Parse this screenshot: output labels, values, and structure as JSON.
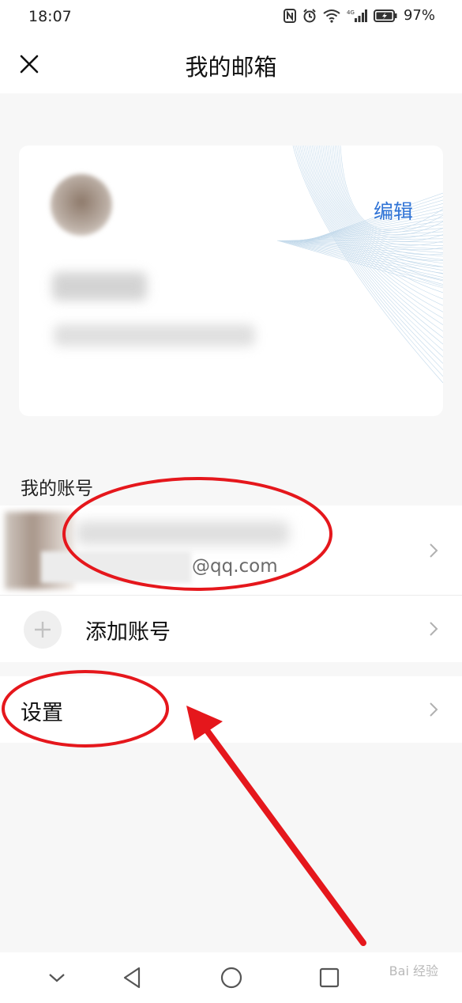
{
  "status_bar": {
    "time": "18:07",
    "battery_percent": "97%",
    "icons": [
      "nfc-icon",
      "alarm-icon",
      "wifi-icon",
      "4g-signal-icon",
      "battery-icon"
    ]
  },
  "header": {
    "title": "我的邮箱",
    "close_icon": "close-icon"
  },
  "profile_card": {
    "edit_label": "编辑"
  },
  "accounts_section": {
    "label": "我的账号",
    "account": {
      "email_suffix": "@qq.com"
    },
    "add_account_label": "添加账号"
  },
  "settings": {
    "label": "设置"
  },
  "nav_bar": {
    "icons": [
      "collapse-down-icon",
      "back-icon",
      "home-icon",
      "recents-icon"
    ]
  },
  "watermark": {
    "text": "Bai 经验"
  },
  "colors": {
    "accent": "#2f73d6",
    "annotation_red": "#e5171c",
    "background": "#f7f7f7"
  }
}
